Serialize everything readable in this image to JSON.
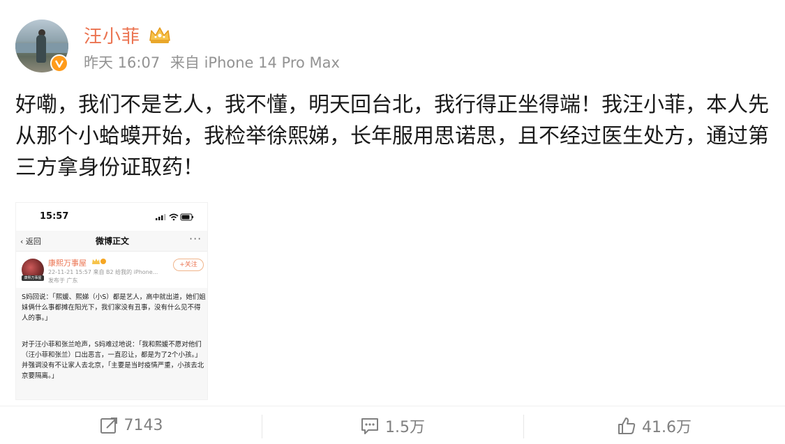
{
  "author": {
    "name": "汪小菲",
    "crown_icon": "crown-icon",
    "verified_icon": "verified-v-badge-icon"
  },
  "meta": {
    "time": "昨天 16:07",
    "source": "来自 iPhone 14 Pro Max"
  },
  "post": {
    "text": "好嘞，我们不是艺人，我不懂，明天回台北，我行得正坐得端！我汪小菲，本人先从那个小蛤蟆开始，我检举徐熙娣，长年服用思诺思，且不经过医生处方，通过第三方拿身份证取药！"
  },
  "embedded_screenshot": {
    "status_time": "15:57",
    "back_label": "返回",
    "nav_title": "微博正文",
    "more": "···",
    "author_name": "康熙万事屋",
    "author_tag": "康熙万事屋",
    "sub_line": "22-11-21 15:57  来自 B2 给我的 iPhone...",
    "location": "发布于 广东",
    "follow_label": "+关注",
    "paragraph1": "S妈回说：「熙媛、熙娣（小S）都是艺人，高中就出道，她们姐妹俩什么事都摊在阳光下，我们家没有丑事，没有什么见不得人的事。」",
    "paragraph2": "对于汪小菲和张兰呛声，S妈难过地说：「我和熙媛不愿对他们（汪小菲和张兰）口出恶言，一直忍让，都是为了2个小孩。」并强调没有不让家人去北京，「主要是当时疫情严重，小孩去北京要隔离。」"
  },
  "actions": {
    "repost_count": "7143",
    "comment_count": "1.5万",
    "like_count": "41.6万"
  },
  "colors": {
    "username": "#eb7350",
    "meta": "#939393",
    "action": "#808080"
  }
}
